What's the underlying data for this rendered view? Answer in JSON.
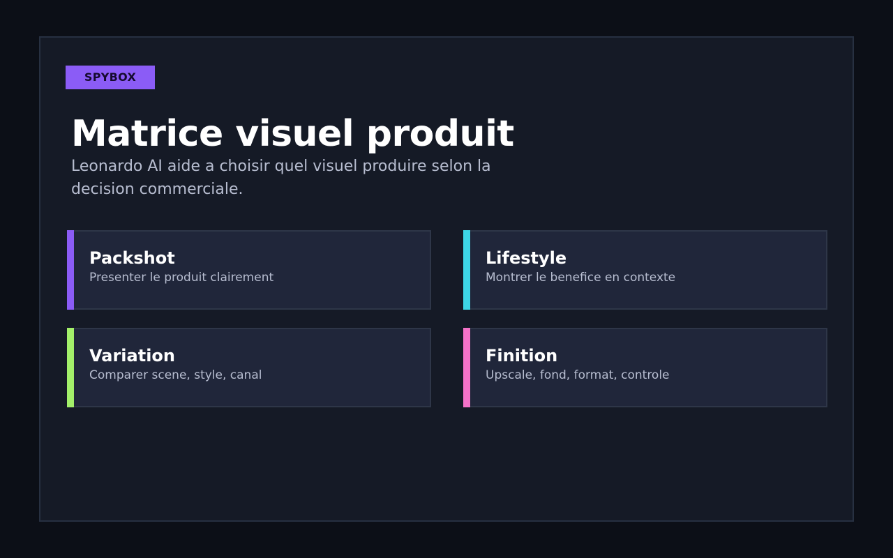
{
  "badge": "SPYBOX",
  "title": "Matrice visuel produit",
  "subtitle": "Leonardo AI aide a choisir quel visuel produire selon la decision commerciale.",
  "colors": {
    "badge": "#8b5cf6",
    "background": "#0c0f17",
    "panel": "#151a26",
    "card": "#20263a"
  },
  "cards": [
    {
      "title": "Packshot",
      "description": "Presenter le produit clairement",
      "accent": "#8b5cf6"
    },
    {
      "title": "Lifestyle",
      "description": "Montrer le benefice en contexte",
      "accent": "#3dd6e6"
    },
    {
      "title": "Variation",
      "description": "Comparer scene, style, canal",
      "accent": "#a3f06a"
    },
    {
      "title": "Finition",
      "description": "Upscale, fond, format, controle",
      "accent": "#f472c8"
    }
  ]
}
